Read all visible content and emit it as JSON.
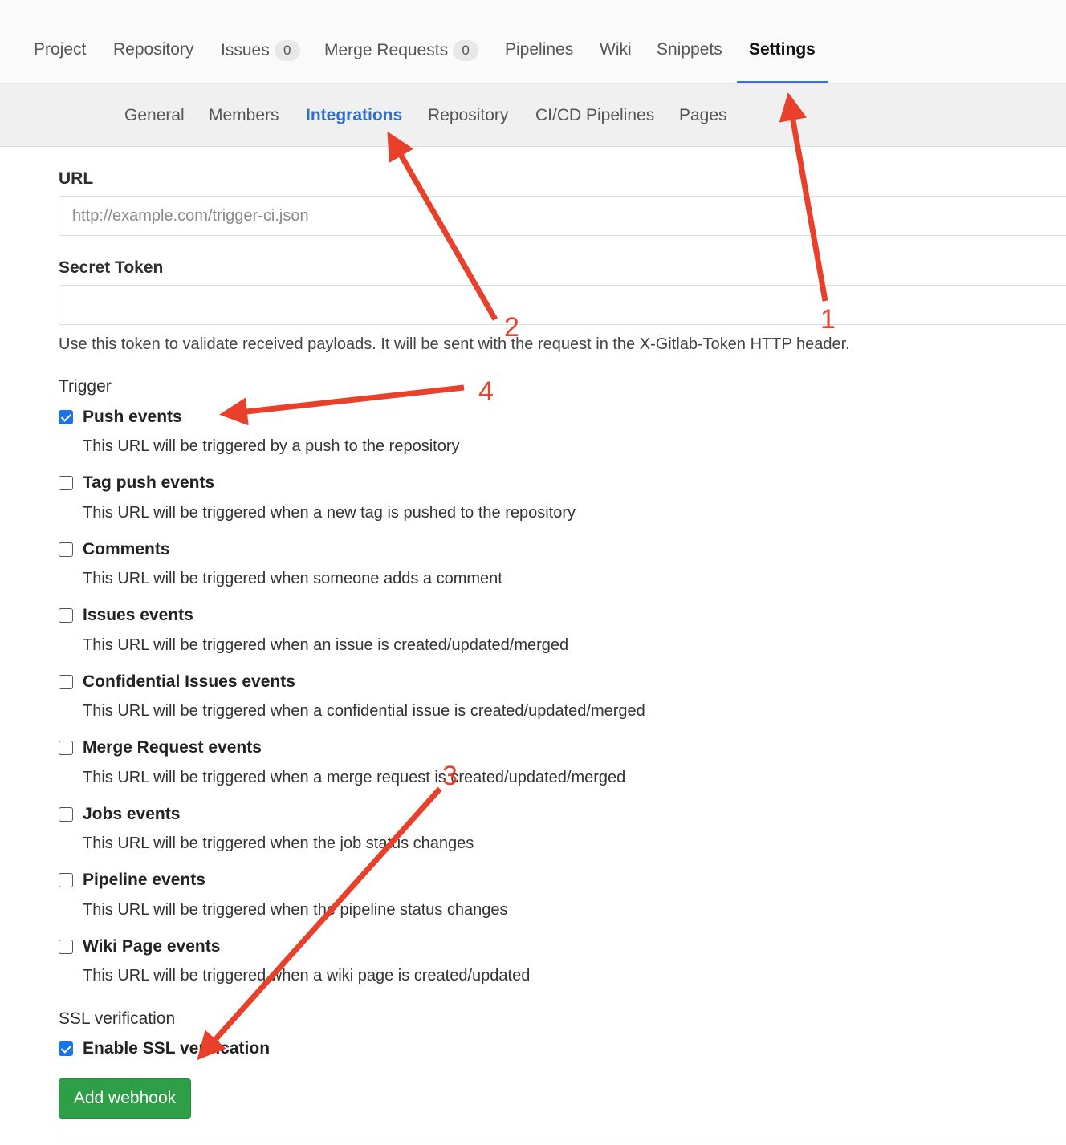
{
  "top_nav": {
    "tabs": [
      {
        "label": "Project"
      },
      {
        "label": "Repository"
      },
      {
        "label": "Issues",
        "badge": "0"
      },
      {
        "label": "Merge Requests",
        "badge": "0"
      },
      {
        "label": "Pipelines"
      },
      {
        "label": "Wiki"
      },
      {
        "label": "Snippets"
      },
      {
        "label": "Settings",
        "active": true
      }
    ]
  },
  "sub_nav": {
    "tabs": [
      {
        "label": "General"
      },
      {
        "label": "Members"
      },
      {
        "label": "Integrations",
        "active": true
      },
      {
        "label": "Repository"
      },
      {
        "label": "CI/CD Pipelines"
      },
      {
        "label": "Pages"
      }
    ]
  },
  "form": {
    "url_label": "URL",
    "url_placeholder": "http://example.com/trigger-ci.json",
    "url_value": "",
    "token_label": "Secret Token",
    "token_value": "",
    "token_help": "Use this token to validate received payloads. It will be sent with the request in the X-Gitlab-Token HTTP header.",
    "trigger_label": "Trigger",
    "triggers": [
      {
        "title": "Push events",
        "desc": "This URL will be triggered by a push to the repository",
        "checked": true
      },
      {
        "title": "Tag push events",
        "desc": "This URL will be triggered when a new tag is pushed to the repository",
        "checked": false
      },
      {
        "title": "Comments",
        "desc": "This URL will be triggered when someone adds a comment",
        "checked": false
      },
      {
        "title": "Issues events",
        "desc": "This URL will be triggered when an issue is created/updated/merged",
        "checked": false
      },
      {
        "title": "Confidential Issues events",
        "desc": "This URL will be triggered when a confidential issue is created/updated/merged",
        "checked": false
      },
      {
        "title": "Merge Request events",
        "desc": "This URL will be triggered when a merge request is created/updated/merged",
        "checked": false
      },
      {
        "title": "Jobs events",
        "desc": "This URL will be triggered when the job status changes",
        "checked": false
      },
      {
        "title": "Pipeline events",
        "desc": "This URL will be triggered when the pipeline status changes",
        "checked": false
      },
      {
        "title": "Wiki Page events",
        "desc": "This URL will be triggered when a wiki page is created/updated",
        "checked": false
      }
    ],
    "ssl_label": "SSL verification",
    "ssl_option": {
      "title": "Enable SSL verification",
      "checked": true
    },
    "submit_label": "Add webhook"
  },
  "annotations": {
    "color": "#e8402a",
    "numbers": [
      "1",
      "2",
      "3",
      "4"
    ]
  }
}
